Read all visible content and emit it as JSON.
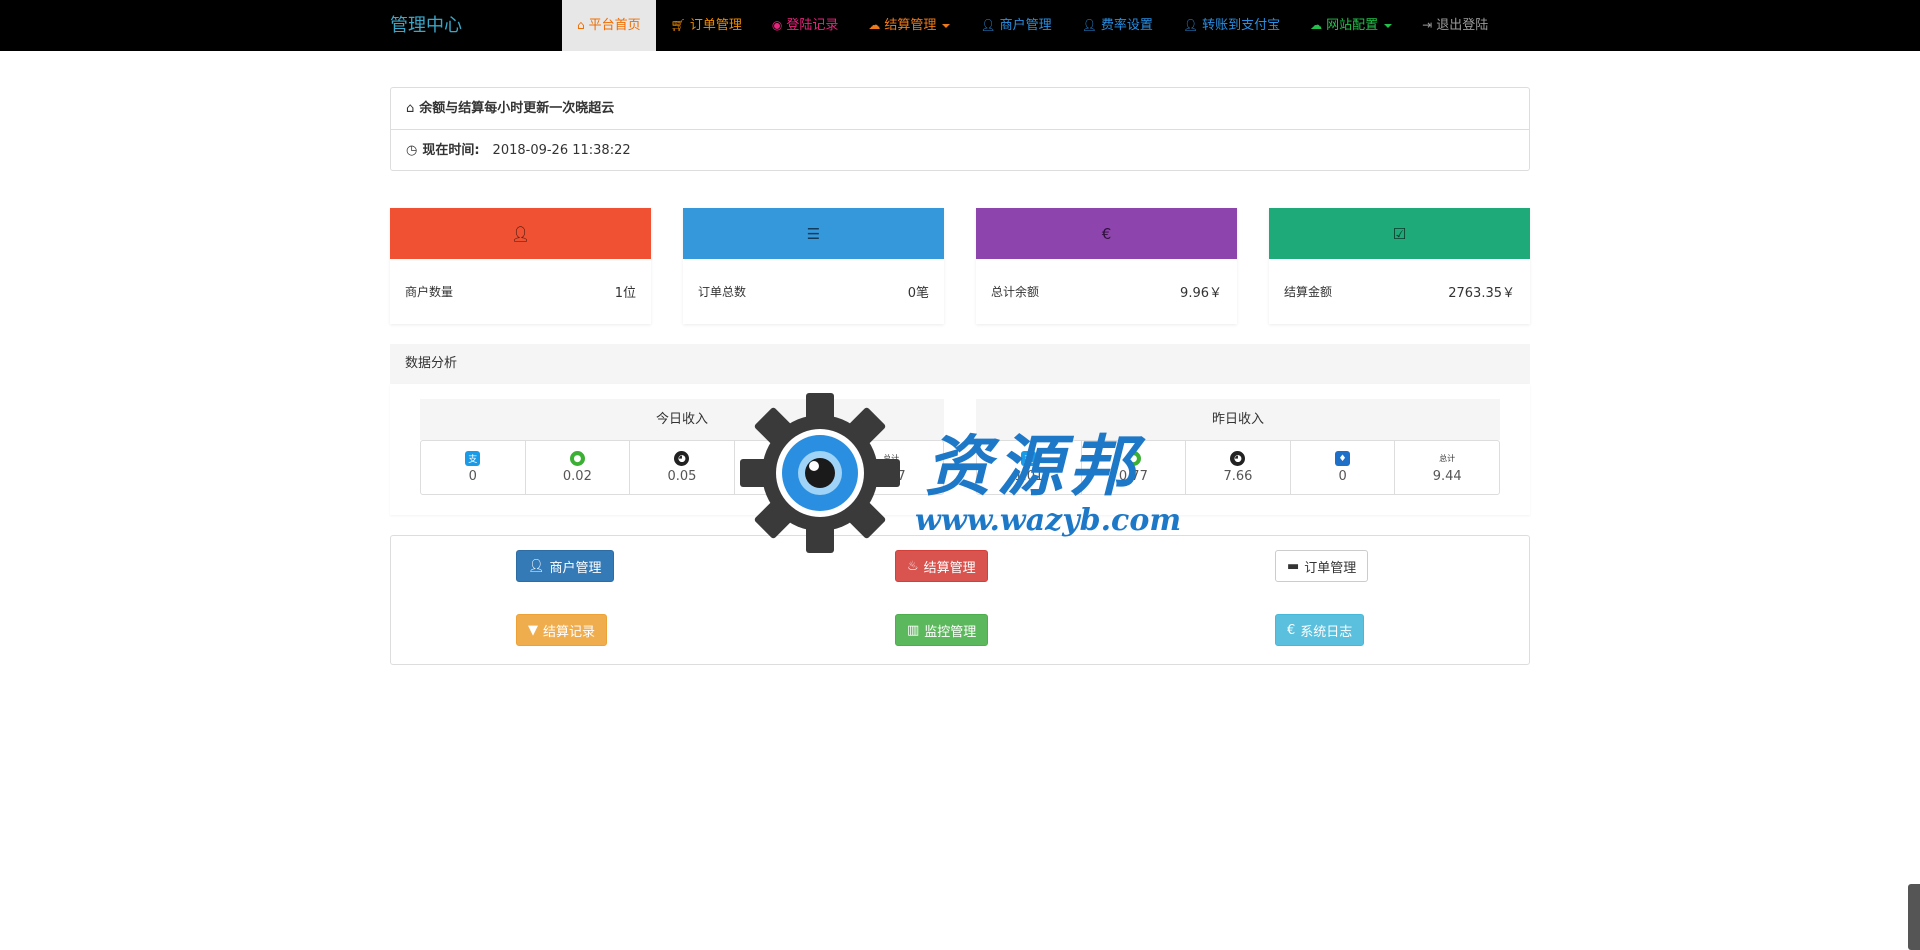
{
  "nav": {
    "brand": "管理中心",
    "items": [
      {
        "label": "平台首页",
        "icon": "home-icon",
        "color": "#ef6c00"
      },
      {
        "label": "订单管理",
        "icon": "cart-icon",
        "color": "#ef8c00"
      },
      {
        "label": "登陆记录",
        "icon": "camera-icon",
        "color": "#e8247c"
      },
      {
        "label": "结算管理",
        "icon": "cloud-icon",
        "color": "#f07a1a"
      },
      {
        "label": "商户管理",
        "icon": "user-icon",
        "color": "#2a8ee0"
      },
      {
        "label": "费率设置",
        "icon": "user-icon",
        "color": "#2a8ee0"
      },
      {
        "label": "转账到支付宝",
        "icon": "user-icon",
        "color": "#2a8ee0"
      },
      {
        "label": "网站配置",
        "icon": "cloud-icon",
        "color": "#22c14a"
      },
      {
        "label": "退出登陆",
        "icon": "logout-icon",
        "color": "#9a9a9a"
      }
    ]
  },
  "info": {
    "notice": "余额与结算每小时更新一次晓超云",
    "time_label": "现在时间:",
    "time_value": "2018-09-26 11:38:22"
  },
  "stats": [
    {
      "label": "商户数量",
      "value": "1位",
      "color": "#f05133",
      "icon": "user-icon"
    },
    {
      "label": "订单总数",
      "value": "0笔",
      "color": "#3498db",
      "icon": "list-icon"
    },
    {
      "label": "总计余额",
      "value": "9.96￥",
      "color": "#8e44ad",
      "icon": "euro-icon"
    },
    {
      "label": "结算金额",
      "value": "2763.35￥",
      "color": "#1faa7a",
      "icon": "check-icon"
    }
  ],
  "analysis": {
    "title": "数据分析",
    "total_label": "总计",
    "today": {
      "title": "今日收入",
      "cells": [
        {
          "icon": "alipay-icon",
          "value": "0"
        },
        {
          "icon": "wechat-icon",
          "value": "0.02"
        },
        {
          "icon": "qq-icon",
          "value": "0.05"
        },
        {
          "icon": "tenpay-icon",
          "value": "0"
        },
        {
          "icon": "total",
          "value": "0.07"
        }
      ]
    },
    "yesterday": {
      "title": "昨日收入",
      "cells": [
        {
          "icon": "alipay-icon",
          "value": "1.01"
        },
        {
          "icon": "wechat-icon",
          "value": "0.77"
        },
        {
          "icon": "qq-icon",
          "value": "7.66"
        },
        {
          "icon": "tenpay-icon",
          "value": "0"
        },
        {
          "icon": "total",
          "value": "9.44"
        }
      ]
    }
  },
  "actions": [
    {
      "label": "商户管理",
      "style": "primary",
      "icon": "user-icon"
    },
    {
      "label": "结算管理",
      "style": "danger",
      "icon": "fire-icon"
    },
    {
      "label": "订单管理",
      "style": "default",
      "icon": "minus-icon"
    },
    {
      "label": "结算记录",
      "style": "warning",
      "icon": "filter-icon"
    },
    {
      "label": "监控管理",
      "style": "success",
      "icon": "barcode-icon"
    },
    {
      "label": "系统日志",
      "style": "info",
      "icon": "euro-icon"
    }
  ],
  "watermark": {
    "text": "资源邦",
    "url": "www.wazyb.com"
  }
}
